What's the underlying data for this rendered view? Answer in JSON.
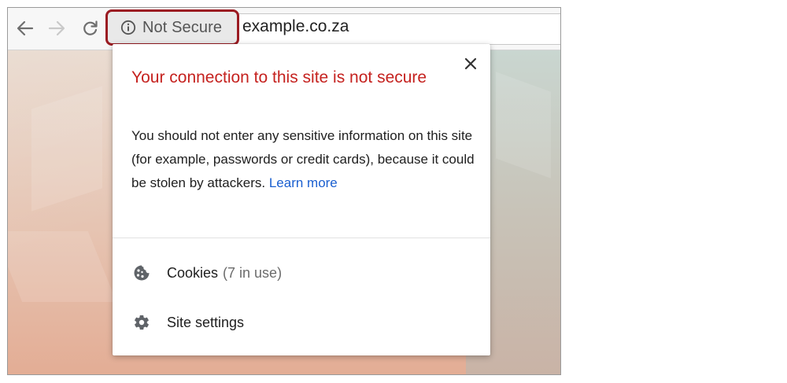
{
  "browser": {
    "security_chip_label": "Not Secure",
    "url": "example.co.za",
    "accent_color": "#9b1b22"
  },
  "popup": {
    "title": "Your connection to this site is not secure",
    "body_text": "You should not enter any sensitive information on this site (for example, passwords or credit cards), because it could be stolen by attackers.",
    "learn_more_label": "Learn more",
    "title_color": "#c5221f",
    "link_color": "#1a5fd0",
    "rows": [
      {
        "icon": "cookie-icon",
        "label": "Cookies",
        "detail": "(7 in use)"
      },
      {
        "icon": "gear-icon",
        "label": "Site settings"
      }
    ]
  }
}
